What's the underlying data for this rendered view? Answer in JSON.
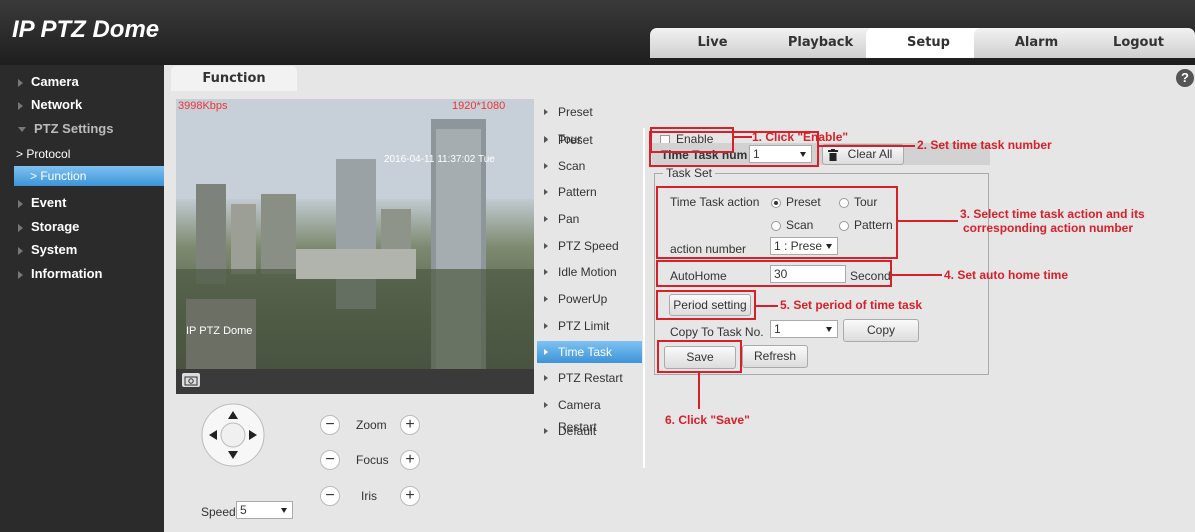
{
  "header": {
    "brand": "IP PTZ Dome",
    "tabs": [
      {
        "label": "Live"
      },
      {
        "label": "Playback"
      },
      {
        "label": "Setup",
        "active": true
      },
      {
        "label": "Alarm"
      },
      {
        "label": "Logout"
      }
    ]
  },
  "sidebar": {
    "items": [
      {
        "label": "Camera"
      },
      {
        "label": "Network"
      },
      {
        "label": "PTZ Settings"
      },
      {
        "label": "Event"
      },
      {
        "label": "Storage"
      },
      {
        "label": "System"
      },
      {
        "label": "Information"
      }
    ],
    "sub_items": [
      {
        "label": "> Protocol"
      },
      {
        "label": "> Function",
        "active": true
      }
    ]
  },
  "content": {
    "tab": "Function",
    "help": "?"
  },
  "video": {
    "bitrate": "3998Kbps",
    "resolution": "1920*1080",
    "timestamp": "2016-04-11 11:37:02 Tue",
    "channel_title": "IP PTZ Dome"
  },
  "ptz_control": {
    "zoom_label": "Zoom",
    "focus_label": "Focus",
    "iris_label": "Iris",
    "speed_label": "Speed",
    "speed_value": "5",
    "minus": "−",
    "plus": "+"
  },
  "ptz_menu": [
    {
      "label": "Preset"
    },
    {
      "label": "Tour"
    },
    {
      "label": "Scan"
    },
    {
      "label": "Pattern"
    },
    {
      "label": "Pan"
    },
    {
      "label": "PTZ Speed"
    },
    {
      "label": "Idle Motion"
    },
    {
      "label": "PowerUp"
    },
    {
      "label": "PTZ Limit"
    },
    {
      "label": "Time Task",
      "active": true
    },
    {
      "label": "PTZ Restart"
    },
    {
      "label": "Camera Restart"
    },
    {
      "label": "Default"
    }
  ],
  "form": {
    "enable_label": "Enable",
    "time_task_num_label": "Time Task num",
    "time_task_num_value": "1",
    "clear_all_label": "Clear All",
    "task_set_legend": "Task Set",
    "time_task_action_label": "Time Task action",
    "action_options": [
      "Preset",
      "Tour",
      "Scan",
      "Pattern"
    ],
    "action_selected": "Preset",
    "action_number_label": "action number",
    "action_number_value": "1 : Prese",
    "autohome_label": "AutoHome",
    "autohome_value": "30",
    "autohome_unit": "Second",
    "period_setting_label": "Period setting",
    "copy_to_label": "Copy To Task No.",
    "copy_to_value": "1",
    "copy_label": "Copy",
    "save_label": "Save",
    "refresh_label": "Refresh"
  },
  "annotations": {
    "a1": "1. Click \"Enable\"",
    "a2": "2. Set time task number",
    "a3_line1": "3. Select time task action and its",
    "a3_line2": "corresponding action number",
    "a4": "4. Set auto home time",
    "a5": "5. Set period of time task",
    "a6": "6. Click \"Save\""
  },
  "colors": {
    "accent": "#3c94d8",
    "annotation_red": "#d6202a",
    "topbar": "#1e1e1e"
  }
}
